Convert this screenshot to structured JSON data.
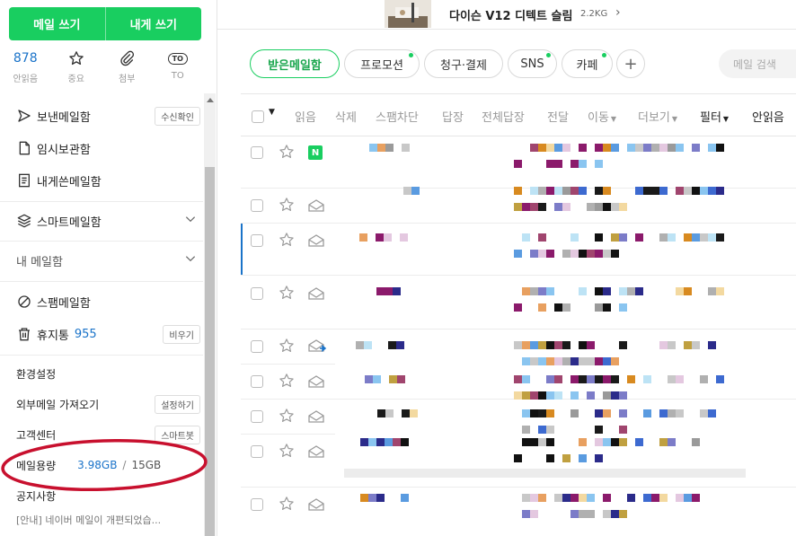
{
  "compose": {
    "write_mail": "메일 쓰기",
    "write_self": "내게 쓰기"
  },
  "quick": [
    {
      "value": "878",
      "label": "안읽음",
      "icon": "unread-count"
    },
    {
      "value": "",
      "label": "중요",
      "icon": "star-icon"
    },
    {
      "value": "",
      "label": "첨부",
      "icon": "paperclip-icon"
    },
    {
      "value": "TO",
      "label": "TO",
      "icon": "to-icon"
    }
  ],
  "sidebar": {
    "sent": {
      "label": "보낸메일함",
      "pill": "수신확인"
    },
    "drafts": {
      "label": "임시보관함"
    },
    "self_box": {
      "label": "내게쓴메일함"
    },
    "smart": {
      "label": "스마트메일함"
    },
    "my": {
      "label": "내 메일함"
    },
    "spam": {
      "label": "스팸메일함"
    },
    "trash": {
      "label": "휴지통",
      "count": "955",
      "pill": "비우기"
    },
    "settings": "환경설정",
    "external": {
      "label": "외부메일 가져오기",
      "pill": "설정하기"
    },
    "support": {
      "label": "고객센터",
      "pill": "스마트봇"
    },
    "usage": {
      "label": "메일용량",
      "used": "3.98GB",
      "slash": "/",
      "total": "15GB"
    },
    "notice": {
      "label": "공지사항",
      "text": "[안내] 네이버 메일이 개편되었습..."
    }
  },
  "banner": {
    "product": "다이슨 V12 디텍트 슬림",
    "weight": "2.2KG",
    "arrow": "›"
  },
  "tabs": [
    {
      "label": "받은메일함",
      "active": true,
      "dot": false
    },
    {
      "label": "프로모션",
      "active": false,
      "dot": true
    },
    {
      "label": "청구·결제",
      "active": false,
      "dot": false
    },
    {
      "label": "SNS",
      "active": false,
      "dot": true
    },
    {
      "label": "카페",
      "active": false,
      "dot": true
    }
  ],
  "plus_label": "+",
  "search": {
    "placeholder": "메일 검색"
  },
  "toolbar": {
    "read": "읽음",
    "delete": "삭제",
    "spam_block": "스팸차단",
    "reply": "답장",
    "reply_all": "전체답장",
    "forward": "전달",
    "move": "이동",
    "more": "더보기",
    "filter": "필터",
    "unread": "안읽음"
  },
  "mail_badge": "N",
  "colors": {
    "brand": "#19ce60",
    "link": "#1a73c9",
    "highlight": "#c8102e"
  }
}
